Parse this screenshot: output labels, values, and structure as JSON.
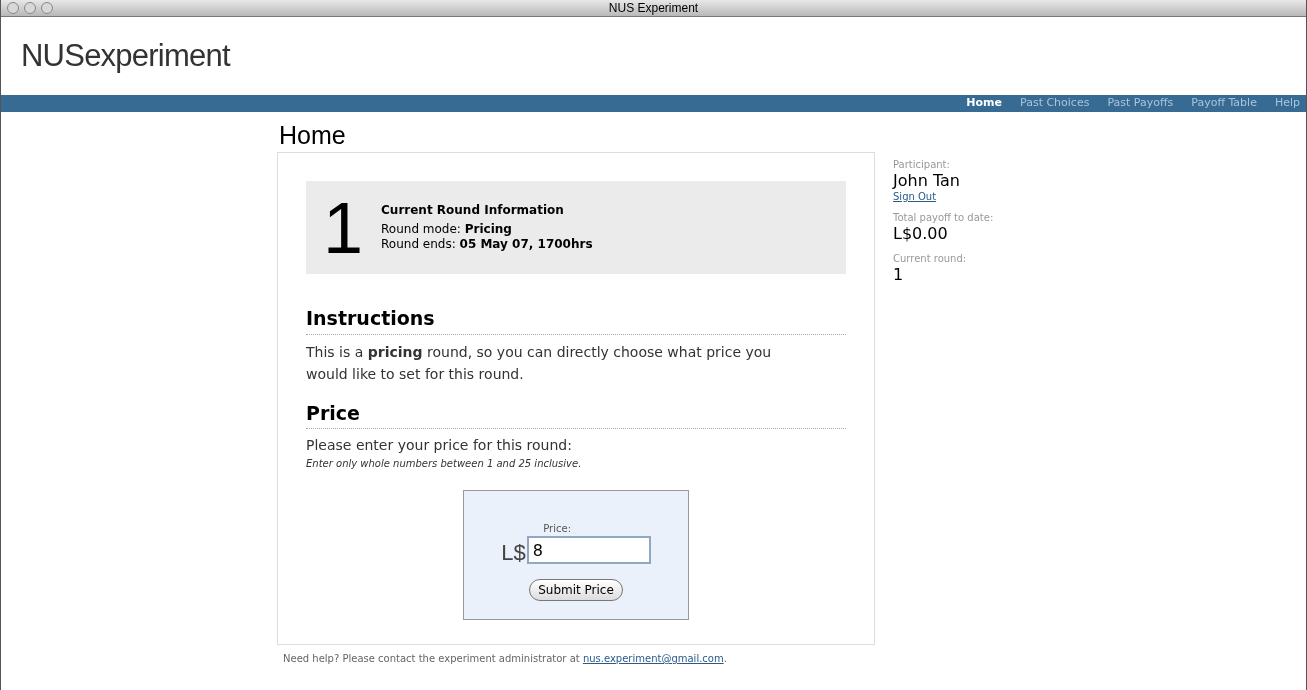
{
  "window": {
    "title": "NUS Experiment"
  },
  "logo": "**NUS**experiment",
  "nav": [
    {
      "label": "Home",
      "selected": true
    },
    {
      "label": "Past Choices",
      "selected": false
    },
    {
      "label": "Past Payoffs",
      "selected": false
    },
    {
      "label": "Payoff Table",
      "selected": false
    },
    {
      "label": "Help",
      "selected": false
    }
  ],
  "page_title": "Home",
  "round_info": {
    "number": "1",
    "title": "Current Round Information",
    "lines": [
      "Round mode: **Pricing**",
      "Round ends: **05 May 07, 1700hrs**"
    ]
  },
  "instructions": {
    "heading": "Instructions",
    "text": "This is a **pricing** round, so you can directly choose what price you would like to set for this round."
  },
  "price": {
    "heading": "Price",
    "prompt": "Please enter your price for this round:",
    "hint": "Enter only whole numbers between 1 and 25 inclusive.",
    "field_label": "Price:",
    "currency": "L$",
    "value": "8",
    "button": "Submit Price"
  },
  "footer": {
    "text": "Need help? Please contact the experiment administrator at ",
    "link": "nus.experiment@gmail.com",
    "text_after": "."
  },
  "sidebar": [
    {
      "label": "Participant:",
      "value": "John Tan",
      "link": "Sign Out"
    },
    {
      "label": "Total payoff to date:",
      "value": "L$0.00"
    },
    {
      "label": "Current round:",
      "value": "1"
    }
  ]
}
